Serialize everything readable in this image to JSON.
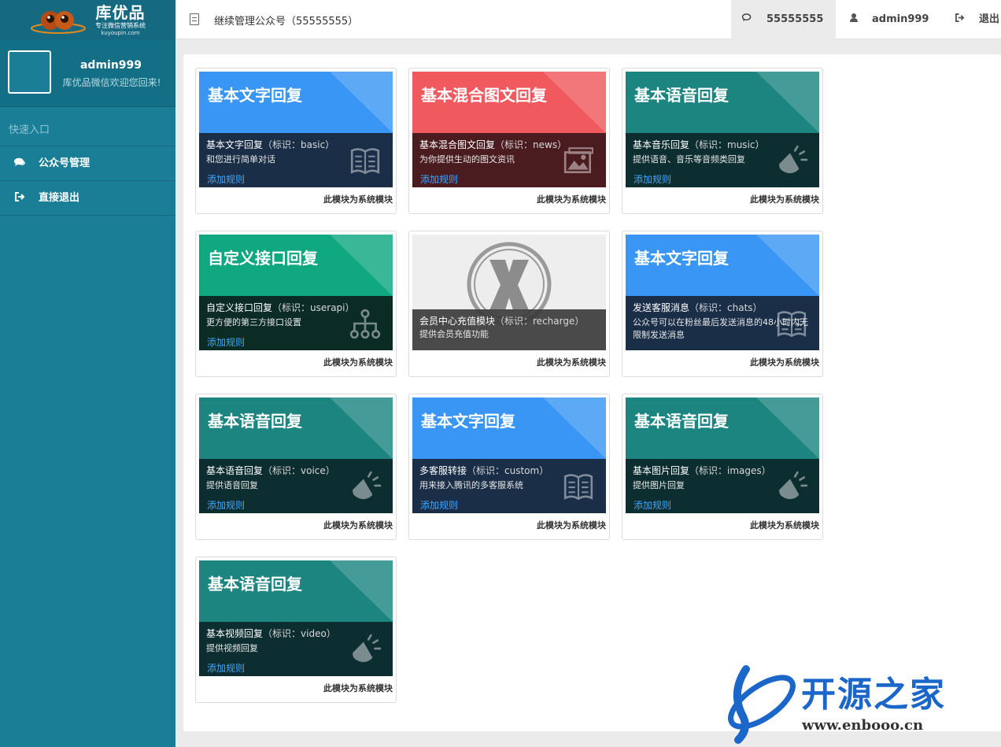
{
  "brand": {
    "name": "库优品",
    "tagline": "专注微信营销系统",
    "domain": "kuyoupin.com"
  },
  "profile": {
    "username": "admin999",
    "welcome": "库优品微信欢迎您回来!"
  },
  "sidebar": {
    "quick_label": "快速入口",
    "items": [
      {
        "label": "公众号管理",
        "icon": "comments-icon"
      },
      {
        "label": "直接退出",
        "icon": "sign-out-icon"
      }
    ]
  },
  "header": {
    "title": "继续管理公众号（55555555）",
    "account": "55555555",
    "user": "admin999",
    "logout": "退出"
  },
  "cards": [
    {
      "theme": "blue",
      "heading": "基本文字回复",
      "name": "基本文字回复",
      "tag": "（标识：basic）",
      "desc": "和您进行简单对话",
      "add": "添加规则",
      "icon": "book-icon",
      "footer": "此模块为系统模块"
    },
    {
      "theme": "red",
      "heading": "基本混合图文回复",
      "name": "基本混合图文回复",
      "tag": "（标识：news）",
      "desc": "为你提供生动的图文资讯",
      "add": "添加规则",
      "icon": "image-icon",
      "footer": "此模块为系统模块"
    },
    {
      "theme": "teal",
      "heading": "基本语音回复",
      "name": "基本音乐回复",
      "tag": "（标识：music）",
      "desc": "提供语音、音乐等音频类回复",
      "add": "添加规则",
      "icon": "speaker-icon",
      "footer": "此模块为系统模块"
    },
    {
      "theme": "green",
      "heading": "自定义接口回复",
      "name": "自定义接口回复",
      "tag": "（标识：userapi）",
      "desc": "更方便的第三方接口设置",
      "add": "添加规则",
      "icon": "sitemap-icon",
      "footer": "此模块为系统模块"
    },
    {
      "theme": "gray",
      "heading": "",
      "name": "会员中心充值模块",
      "tag": "（标识：recharge）",
      "desc": "提供会员充值功能",
      "add": "",
      "icon": "x-circle-icon",
      "footer": "此模块为系统模块"
    },
    {
      "theme": "blue",
      "heading": "基本文字回复",
      "name": "发送客服消息",
      "tag": "（标识：chats）",
      "desc": "公众号可以在粉丝最后发送消息的48小时内无限制发送消息",
      "add": "",
      "icon": "book-icon",
      "footer": "此模块为系统模块"
    },
    {
      "theme": "teal",
      "heading": "基本语音回复",
      "name": "基本语音回复",
      "tag": "（标识：voice）",
      "desc": "提供语音回复",
      "add": "添加规则",
      "icon": "speaker-icon",
      "footer": "此模块为系统模块"
    },
    {
      "theme": "blue",
      "heading": "基本文字回复",
      "name": "多客服转接",
      "tag": "（标识：custom）",
      "desc": "用来接入腾讯的多客服系统",
      "add": "添加规则",
      "icon": "book-icon",
      "footer": "此模块为系统模块"
    },
    {
      "theme": "teal",
      "heading": "基本语音回复",
      "name": "基本图片回复",
      "tag": "（标识：images）",
      "desc": "提供图片回复",
      "add": "添加规则",
      "icon": "speaker-icon",
      "footer": "此模块为系统模块"
    },
    {
      "theme": "teal",
      "heading": "基本语音回复",
      "name": "基本视频回复",
      "tag": "（标识：video）",
      "desc": "提供视频回复",
      "add": "添加规则",
      "icon": "speaker-icon",
      "footer": "此模块为系统模块"
    }
  ],
  "watermark": {
    "text": "开源之家",
    "url": "www.enbooo.cn"
  }
}
